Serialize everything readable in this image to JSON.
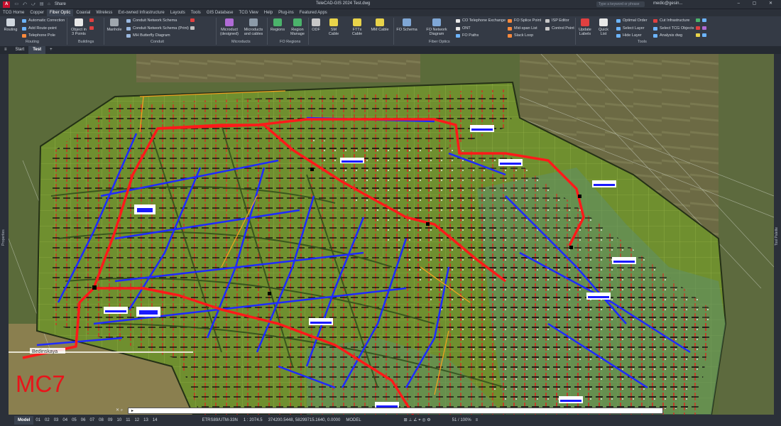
{
  "app": {
    "logo": "A",
    "title": "TeleCAD-GIS 2024 Test.dwg",
    "share": "Share",
    "search_placeholder": "Type a keyword or phrase",
    "user": "medic@gesin..."
  },
  "tabs": [
    "TCG Home",
    "Copper",
    "Fiber Optic",
    "Coaxial",
    "Wireless",
    "Ext-owned Infrastructure",
    "Layouts",
    "Tools",
    "GIS Database",
    "TCG View",
    "Help",
    "Plug-ins",
    "Featured Apps"
  ],
  "active_tab": "Fiber Optic",
  "ribbon": {
    "routing_big": "Routing",
    "routing_items": [
      "Automatic Correction",
      "Add Route-point",
      "Telephone Pole"
    ],
    "buildings_big": "Object in 3 Points",
    "manhole": "Manhole",
    "conduit_items": [
      "Conduit Network Schema",
      "Conduit Network Schema (Print)",
      "MH Butterfly Diagram"
    ],
    "microduct_designed": "Microduct (designed)",
    "microducts_cables": "Microducts and cables",
    "regions": "Regions",
    "region_manage": "Region Manage",
    "odf": "ODF",
    "sm_cable": "SM Cable",
    "ftth_cable": "FTTx Cable",
    "mm_cable": "MM Cable",
    "fo_schema": "FO Schema",
    "fo_network_diagram": "FO Network Diagram",
    "fiber_items": [
      "CO Telephone Exchange",
      "ONT",
      "FO Paths"
    ],
    "splice_items": [
      "FO Splice Point",
      "Mid-span List",
      "Slack Loop"
    ],
    "isp_items": [
      "ISP Editor",
      "Control Point"
    ],
    "update_labels": "Update Labels",
    "quick_list": "Quick List",
    "tools_a": [
      "Optimal Order",
      "Select Layer",
      "Hide Layer"
    ],
    "tools_b": [
      "Cut Infrastructure",
      "Select TCG Objects",
      "Analysis dwg"
    ],
    "groups": [
      "Routing",
      "Buildings",
      "Conduit",
      "Microducts",
      "FO Regions",
      "Fiber Optics",
      "Tools"
    ]
  },
  "doc_tabs": [
    "Start",
    "Test"
  ],
  "side_panels": {
    "left": "Properties",
    "right": "Tool Palette"
  },
  "map": {
    "area_label": "MC7",
    "street_label": "Bedinskaya"
  },
  "statusbar": {
    "model": "Model",
    "layouts": [
      "01",
      "02",
      "03",
      "04",
      "05",
      "06",
      "07",
      "08",
      "09",
      "10",
      "11",
      "12",
      "13",
      "14"
    ],
    "crs": "ETRS89/UTM-33N",
    "scale": "1 : 2074.5",
    "coords": "374200.5448, 58299715.1640, 0.0000",
    "space": "MODEL",
    "zoom": "51 / 100%"
  },
  "colors": {
    "trunk": "#ff1a1a",
    "branch": "#1f2bff",
    "accent": "#c8102e"
  }
}
